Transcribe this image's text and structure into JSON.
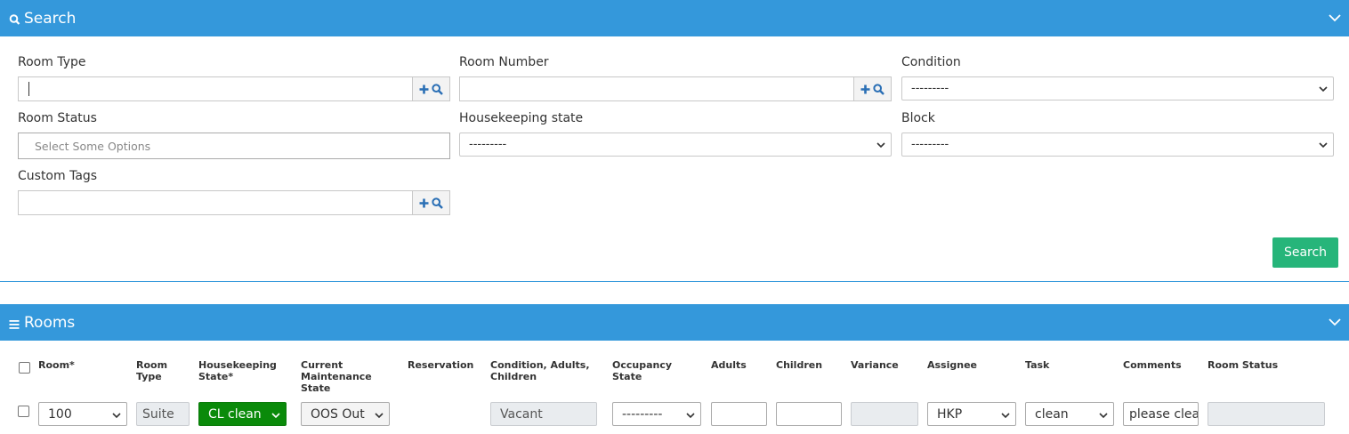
{
  "search_panel": {
    "title": "Search",
    "fields": {
      "room_type": {
        "label": "Room Type",
        "value": ""
      },
      "room_number": {
        "label": "Room Number",
        "value": ""
      },
      "condition": {
        "label": "Condition",
        "value": "---------"
      },
      "room_status": {
        "label": "Room Status",
        "placeholder": "Select Some Options"
      },
      "housekeeping_state": {
        "label": "Housekeeping state",
        "value": "---------"
      },
      "block": {
        "label": "Block",
        "value": "---------"
      },
      "custom_tags": {
        "label": "Custom Tags",
        "value": ""
      }
    },
    "search_button": "Search"
  },
  "rooms_panel": {
    "title": "Rooms",
    "columns": {
      "room": "Room*",
      "room_type": "Room Type",
      "housekeeping_state": "Housekeeping State*",
      "maintenance_state": "Current Maintenance State",
      "reservation": "Reservation",
      "condition": "Condition, Adults, Children",
      "occupancy_state": "Occupancy State",
      "adults": "Adults",
      "children": "Children",
      "variance": "Variance",
      "assignee": "Assignee",
      "task": "Task",
      "comments": "Comments",
      "room_status": "Room Status"
    },
    "row": {
      "room": "100",
      "room_type": "Suite",
      "housekeeping_state": "CL clean",
      "maintenance_state": "OOS Out",
      "condition": "Vacant",
      "occupancy_state": "---------",
      "adults": "",
      "children": "",
      "variance": "",
      "assignee": "HKP",
      "task": "clean",
      "comments": "please clea",
      "room_status": ""
    }
  },
  "colors": {
    "header_bg": "#3498db",
    "search_button": "#26b57a",
    "housekeeping_clean": "#0a8a0a"
  }
}
